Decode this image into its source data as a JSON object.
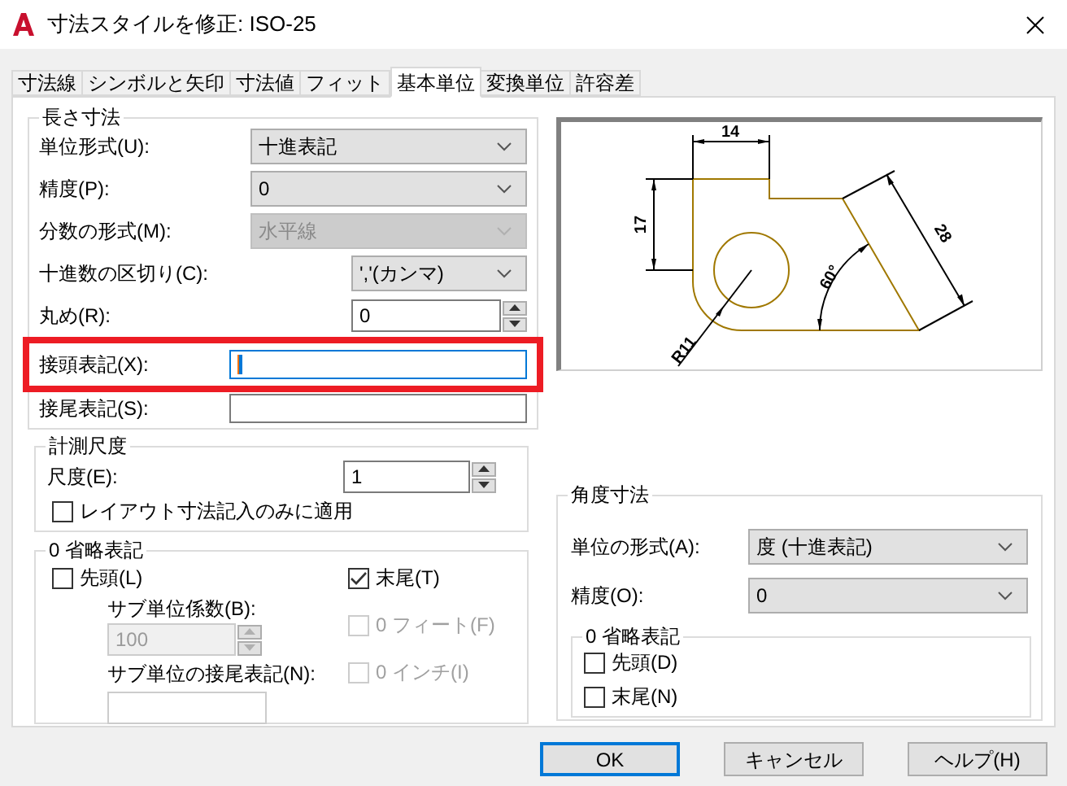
{
  "window": {
    "title": "寸法スタイルを修正: ISO-25"
  },
  "tabs": [
    {
      "label": "寸法線",
      "selected": false
    },
    {
      "label": "シンボルと矢印",
      "selected": false
    },
    {
      "label": "寸法値",
      "selected": false
    },
    {
      "label": "フィット",
      "selected": false
    },
    {
      "label": "基本単位",
      "selected": true
    },
    {
      "label": "変換単位",
      "selected": false
    },
    {
      "label": "許容差",
      "selected": false
    }
  ],
  "length_section": {
    "title": "長さ寸法",
    "rows": [
      {
        "kind": "select",
        "label": "単位形式(U):",
        "value": "十進表記",
        "disabled": false,
        "highlighted": false
      },
      {
        "kind": "select",
        "label": "精度(P):",
        "value": "0",
        "disabled": false,
        "highlighted": false
      },
      {
        "kind": "select",
        "label": "分数の形式(M):",
        "value": "水平線",
        "disabled": true,
        "highlighted": false
      },
      {
        "kind": "select_short",
        "label": "十進数の区切り(C):",
        "value": "','(カンマ)",
        "disabled": false,
        "highlighted": false
      },
      {
        "kind": "spin",
        "label": "丸め(R):",
        "value": "0",
        "disabled": false,
        "highlighted": false
      },
      {
        "kind": "text",
        "label": "接頭表記(X):",
        "focused": true,
        "highlighted": true
      },
      {
        "kind": "text",
        "label": "接尾表記(S):",
        "focused": false,
        "highlighted": false
      }
    ]
  },
  "scale_section": {
    "title": "計測尺度",
    "label": "尺度(E):",
    "value": "1",
    "checkbox": {
      "label": "レイアウト寸法記入のみに適用",
      "checked": false
    }
  },
  "zero_section": {
    "title": "0 省略表記",
    "leading": {
      "label": "先頭(L)",
      "checked": false,
      "disabled": false
    },
    "sub_factor": {
      "label": "サブ単位係数(B):",
      "value": "100"
    },
    "sub_suffix": {
      "label": "サブ単位の接尾表記(N):"
    },
    "trailing": {
      "label": "末尾(T)",
      "checked": true,
      "disabled": false
    },
    "feet": {
      "label": "0 フィート(F)",
      "checked": false,
      "disabled": true
    },
    "inches": {
      "label": "0 インチ(I)",
      "checked": false,
      "disabled": true
    }
  },
  "preview": {
    "labels": [
      "14",
      "17",
      "28",
      "60°",
      "R11"
    ]
  },
  "angular_section": {
    "title": "角度寸法",
    "rows": [
      {
        "label": "単位の形式(A):",
        "value": "度 (十進表記)"
      },
      {
        "label": "精度(O):",
        "value": "0"
      }
    ],
    "zero_title": "0 省略表記",
    "checkboxes": [
      {
        "label": "先頭(D)",
        "checked": false
      },
      {
        "label": "末尾(N)",
        "checked": false
      }
    ]
  },
  "buttons": [
    {
      "label": "OK",
      "default": true
    },
    {
      "label": "キャンセル",
      "default": false
    },
    {
      "label": "ヘルプ(H)",
      "default": false
    }
  ]
}
